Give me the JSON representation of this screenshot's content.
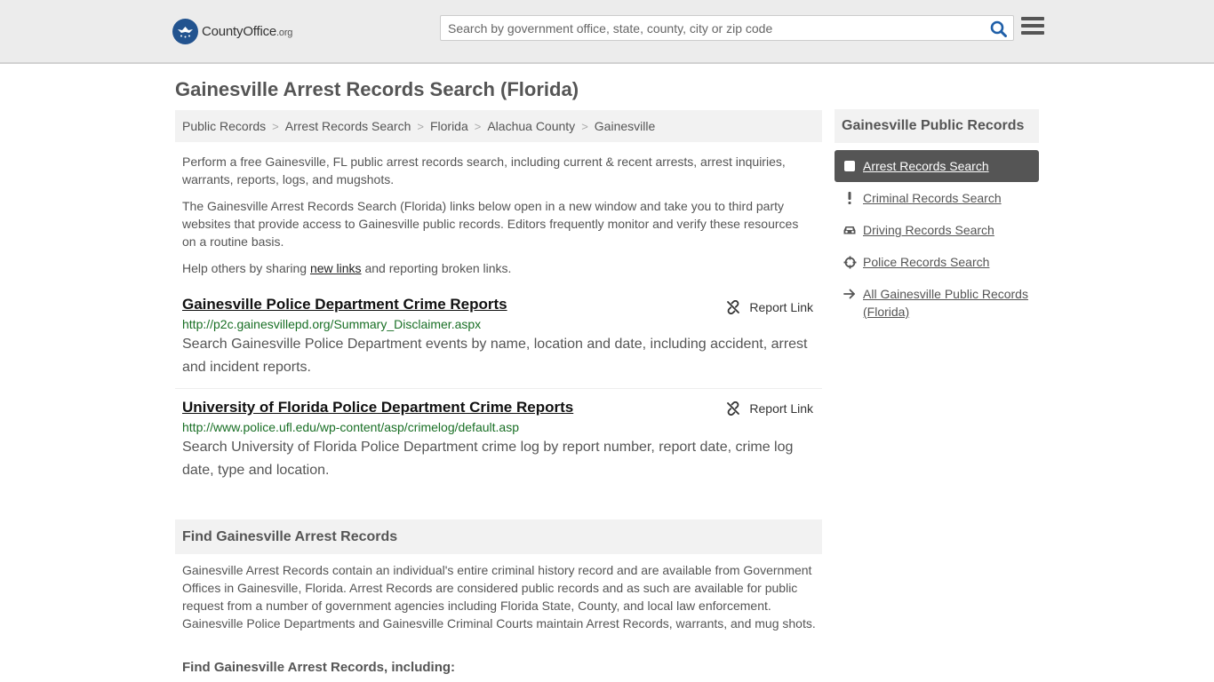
{
  "header": {
    "logo_main": "CountyOffice",
    "logo_suffix": ".org",
    "search_placeholder": "Search by government office, state, county, city or zip code"
  },
  "page_title": "Gainesville Arrest Records Search (Florida)",
  "breadcrumb": [
    "Public Records",
    "Arrest Records Search",
    "Florida",
    "Alachua County",
    "Gainesville"
  ],
  "intro": {
    "p1": "Perform a free Gainesville, FL public arrest records search, including current & recent arrests, arrest inquiries, warrants, reports, logs, and mugshots.",
    "p2": "The Gainesville Arrest Records Search (Florida) links below open in a new window and take you to third party websites that provide access to Gainesville public records. Editors frequently monitor and verify these resources on a routine basis.",
    "p3_before": "Help others by sharing ",
    "p3_link": "new links",
    "p3_after": " and reporting broken links."
  },
  "links": [
    {
      "title": "Gainesville Police Department Crime Reports",
      "url": "http://p2c.gainesvillepd.org/Summary_Disclaimer.aspx",
      "description": "Search Gainesville Police Department events by name, location and date, including accident, arrest and incident reports.",
      "report_label": "Report Link"
    },
    {
      "title": "University of Florida Police Department Crime Reports",
      "url": "http://www.police.ufl.edu/wp-content/asp/crimelog/default.asp",
      "description": "Search University of Florida Police Department crime log by report number, report date, crime log date, type and location.",
      "report_label": "Report Link"
    }
  ],
  "find": {
    "heading": "Find Gainesville Arrest Records",
    "text": "Gainesville Arrest Records contain an individual's entire criminal history record and are available from Government Offices in Gainesville, Florida. Arrest Records are considered public records and as such are available for public request from a number of government agencies including Florida State, County, and local law enforcement. Gainesville Police Departments and Gainesville Criminal Courts maintain Arrest Records, warrants, and mug shots.",
    "subheading": "Find Gainesville Arrest Records, including:"
  },
  "sidebar": {
    "heading": "Gainesville Public Records",
    "items": [
      {
        "label": "Arrest Records Search",
        "icon": "square-icon",
        "active": true
      },
      {
        "label": "Criminal Records Search",
        "icon": "exclamation-icon",
        "active": false
      },
      {
        "label": "Driving Records Search",
        "icon": "car-icon",
        "active": false
      },
      {
        "label": "Police Records Search",
        "icon": "crosshair-icon",
        "active": false
      },
      {
        "label": "All Gainesville Public Records (Florida)",
        "icon": "arrow-right-icon",
        "active": false
      }
    ]
  },
  "colors": {
    "url_green": "#196f25",
    "active_bg": "#555555",
    "logo_blue": "#22538f",
    "search_icon": "#1f5fa8"
  }
}
